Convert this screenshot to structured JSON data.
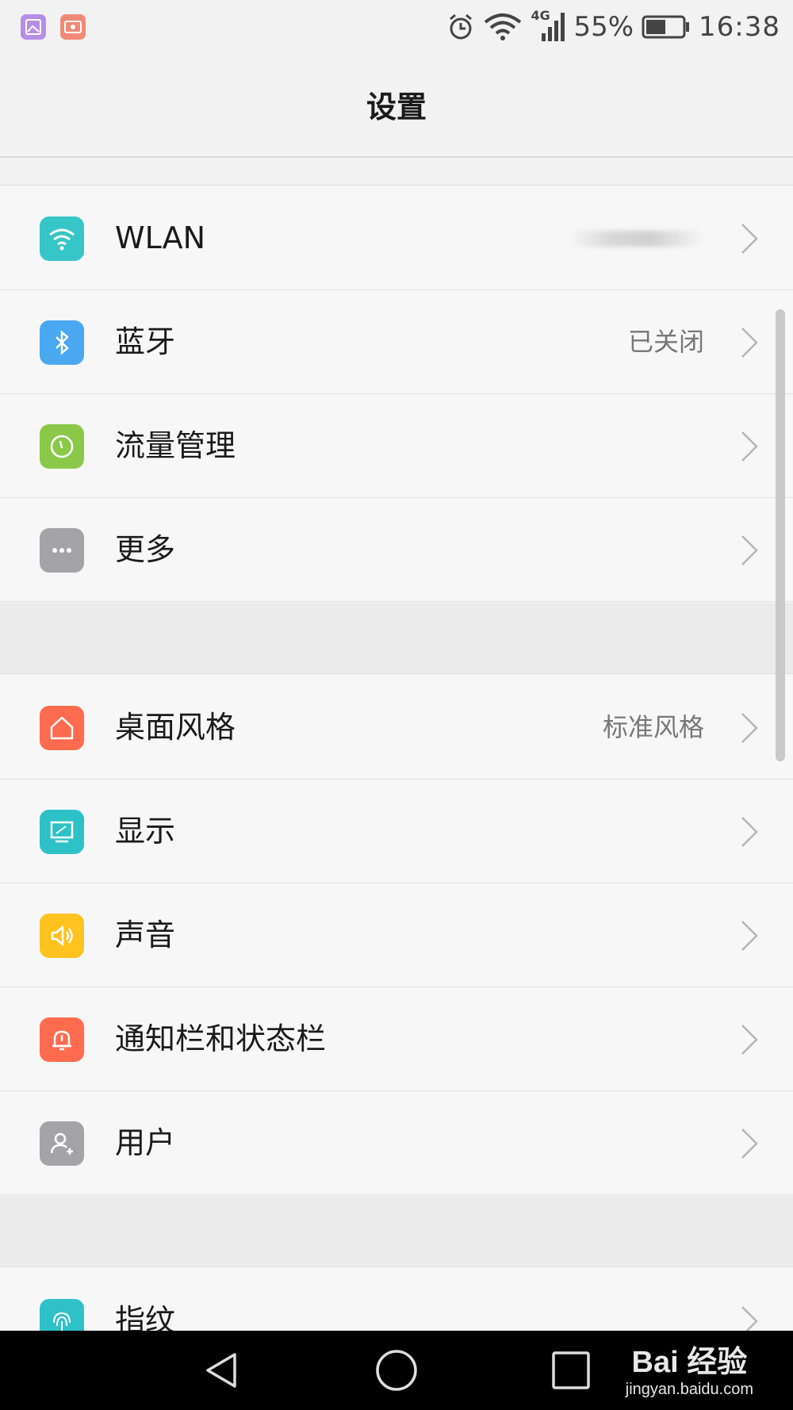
{
  "status_bar": {
    "battery_percent": "55%",
    "time": "16:38",
    "network": "4G",
    "icons": [
      "gallery-app-icon",
      "screen-record-app-icon",
      "alarm-icon",
      "wifi-icon",
      "signal-icon",
      "battery-icon"
    ]
  },
  "header": {
    "title": "设置"
  },
  "section1": {
    "items": [
      {
        "label": "WLAN",
        "value": "",
        "icon": "wifi-icon",
        "color": "#36c6c8"
      },
      {
        "label": "蓝牙",
        "value": "已关闭",
        "icon": "bluetooth-icon",
        "color": "#4aa8f0"
      },
      {
        "label": "流量管理",
        "value": "",
        "icon": "gauge-icon",
        "color": "#8bc84a"
      },
      {
        "label": "更多",
        "value": "",
        "icon": "more-icon",
        "color": "#a3a3a8"
      }
    ]
  },
  "section2": {
    "items": [
      {
        "label": "桌面风格",
        "value": "标准风格",
        "icon": "home-icon",
        "color": "#ff6b4f"
      },
      {
        "label": "显示",
        "value": "",
        "icon": "display-icon",
        "color": "#2ec2c8"
      },
      {
        "label": "声音",
        "value": "",
        "icon": "speaker-icon",
        "color": "#ffc21f"
      },
      {
        "label": "通知栏和状态栏",
        "value": "",
        "icon": "bell-icon",
        "color": "#ff6b4f"
      },
      {
        "label": "用户",
        "value": "",
        "icon": "user-icon",
        "color": "#a3a3a8"
      }
    ]
  },
  "section3": {
    "items": [
      {
        "label": "指纹",
        "value": "",
        "icon": "fingerprint-icon",
        "color": "#2ec2c8"
      }
    ]
  },
  "nav_bar": {
    "buttons": [
      "back-button",
      "home-button",
      "recents-button"
    ]
  },
  "watermark": {
    "brand": "Bai 经验",
    "url": "jingyan.baidu.com"
  }
}
